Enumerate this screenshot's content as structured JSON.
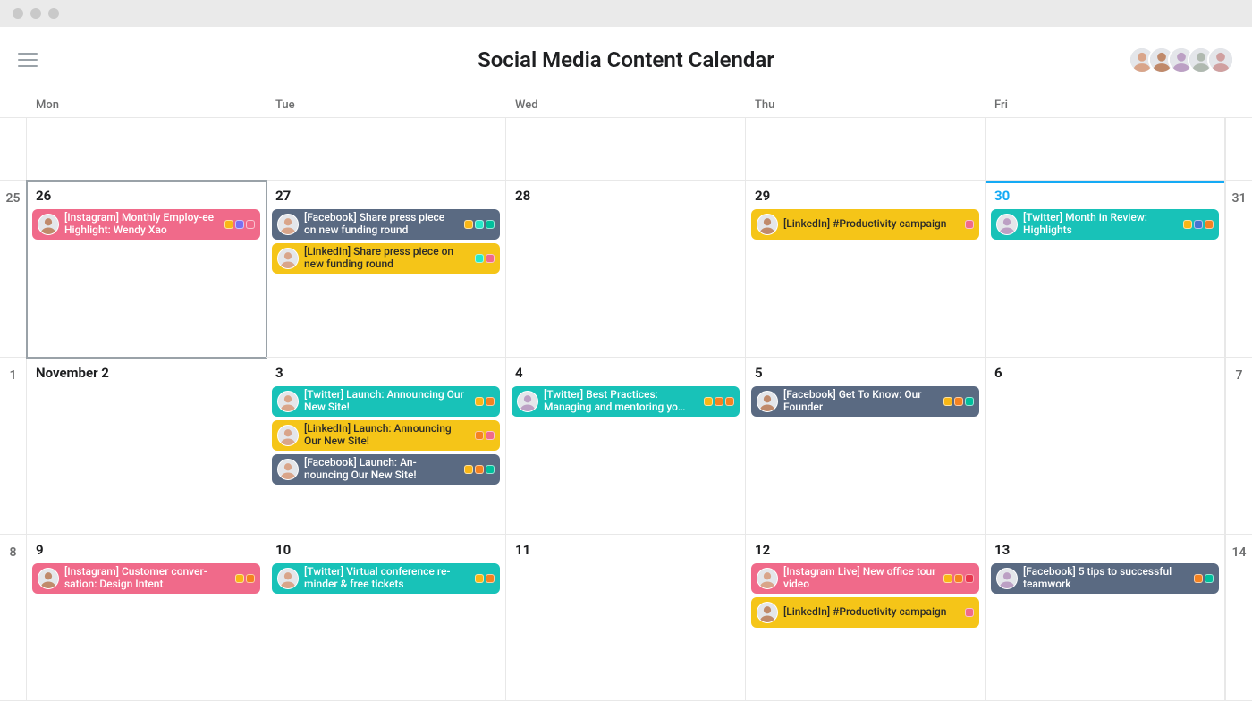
{
  "header": {
    "title": "Social Media Content Calendar",
    "avatars": [
      "user-1",
      "user-2",
      "user-3",
      "user-4",
      "user-5"
    ]
  },
  "dayheads": [
    "Mon",
    "Tue",
    "Wed",
    "Thu",
    "Fri"
  ],
  "weeks": [
    {
      "left_edge": "",
      "right_edge": "",
      "days": [
        {
          "num": "",
          "events": []
        },
        {
          "num": "",
          "events": []
        },
        {
          "num": "",
          "events": []
        },
        {
          "num": "",
          "events": []
        },
        {
          "num": "",
          "events": []
        }
      ]
    },
    {
      "left_edge": "25",
      "right_edge": "31",
      "days": [
        {
          "num": "26",
          "selected": true,
          "events": [
            {
              "color": "pink",
              "avatar": "m1",
              "text": "[Instagram] Monthly Employ-ee Highlight: Wendy Xao",
              "tags": [
                "yellow",
                "purple",
                "pink"
              ]
            }
          ]
        },
        {
          "num": "27",
          "events": [
            {
              "color": "slate",
              "avatar": "f1",
              "text": "[Facebook] Share press piece on new funding round",
              "tags": [
                "yellow",
                "teal",
                "green"
              ]
            },
            {
              "color": "yellow",
              "avatar": "f1",
              "text": "[LinkedIn] Share press piece on new funding round",
              "tags": [
                "teal",
                "pink"
              ]
            }
          ]
        },
        {
          "num": "28",
          "events": []
        },
        {
          "num": "29",
          "events": [
            {
              "color": "yellow",
              "avatar": "m1",
              "text": "[LinkedIn] #Productivity campaign",
              "tags": [
                "pink"
              ]
            }
          ]
        },
        {
          "num": "30",
          "today": true,
          "events": [
            {
              "color": "teal",
              "avatar": "f2",
              "text": "[Twitter] Month in Review: Highlights",
              "tags": [
                "yellow",
                "blue",
                "orange"
              ]
            }
          ]
        }
      ]
    },
    {
      "left_edge": "1",
      "right_edge": "7",
      "days": [
        {
          "num": "November 2",
          "long": true,
          "events": []
        },
        {
          "num": "3",
          "events": [
            {
              "color": "teal",
              "avatar": "f1",
              "text": "[Twitter] Launch: Announcing Our New Site!",
              "tags": [
                "yellow",
                "orange"
              ]
            },
            {
              "color": "yellow",
              "avatar": "f1",
              "text": "[LinkedIn] Launch: Announcing Our New Site!",
              "tags": [
                "orange",
                "pink"
              ]
            },
            {
              "color": "slate",
              "avatar": "f1",
              "text": "[Facebook] Launch: An-nouncing Our New Site!",
              "tags": [
                "yellow",
                "orange",
                "green"
              ]
            }
          ]
        },
        {
          "num": "4",
          "events": [
            {
              "color": "teal",
              "avatar": "f2",
              "text": "[Twitter] Best Practices: Managing and mentoring yo…",
              "tags": [
                "yellow",
                "orange",
                "orange"
              ]
            }
          ]
        },
        {
          "num": "5",
          "events": [
            {
              "color": "slate",
              "avatar": "m1",
              "text": "[Facebook] Get To Know: Our Founder",
              "tags": [
                "yellow",
                "orange",
                "green"
              ]
            }
          ]
        },
        {
          "num": "6",
          "events": []
        }
      ]
    },
    {
      "left_edge": "8",
      "right_edge": "14",
      "days": [
        {
          "num": "9",
          "events": [
            {
              "color": "pink",
              "avatar": "m1",
              "text": "[Instagram] Customer conver-sation: Design Intent",
              "tags": [
                "yellow",
                "orange"
              ]
            }
          ]
        },
        {
          "num": "10",
          "events": [
            {
              "color": "teal",
              "avatar": "f1",
              "text": "[Twitter] Virtual conference re-minder & free tickets",
              "tags": [
                "yellow",
                "orange"
              ]
            }
          ]
        },
        {
          "num": "11",
          "events": []
        },
        {
          "num": "12",
          "events": [
            {
              "color": "pink",
              "avatar": "f1",
              "text": "[Instagram Live] New office tour video",
              "tags": [
                "yellow",
                "orange",
                "red"
              ]
            },
            {
              "color": "yellow",
              "avatar": "m1",
              "text": "[LinkedIn] #Productivity campaign",
              "tags": [
                "pink"
              ]
            }
          ]
        },
        {
          "num": "13",
          "events": [
            {
              "color": "slate",
              "avatar": "f2",
              "text": "[Facebook] 5 tips to successful teamwork",
              "tags": [
                "orange",
                "green"
              ]
            }
          ]
        }
      ]
    }
  ]
}
